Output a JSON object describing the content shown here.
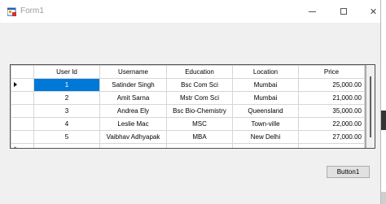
{
  "window": {
    "title": "Form1"
  },
  "caption_buttons": {
    "minimize_icon": "minimize-icon",
    "maximize_icon": "maximize-icon",
    "close_glyph": "✕"
  },
  "grid": {
    "columns": [
      "User Id",
      "Username",
      "Education",
      "Location",
      "Price"
    ],
    "rows": [
      {
        "id": "1",
        "username": "Satinder Singh",
        "education": "Bsc Com Sci",
        "location": "Mumbai",
        "price": "25,000.00"
      },
      {
        "id": "2",
        "username": "Amit Sarna",
        "education": "Mstr Com Sci",
        "location": "Mumbai",
        "price": "21,000.00"
      },
      {
        "id": "3",
        "username": "Andrea Ely",
        "education": "Bsc Bio-Chemistry",
        "location": "Queensland",
        "price": "35,000.00"
      },
      {
        "id": "4",
        "username": "Leslie Mac",
        "education": "MSC",
        "location": "Town-ville",
        "price": "22,000.00"
      },
      {
        "id": "5",
        "username": "Vaibhav Adhyapak",
        "education": "MBA",
        "location": "New Delhi",
        "price": "27,000.00"
      }
    ],
    "new_row_marker": "*",
    "selected_row": 1
  },
  "buttons": {
    "button1": "Button1"
  },
  "colors": {
    "selection": "#0078d7",
    "form_background": "#f0f0f0"
  }
}
